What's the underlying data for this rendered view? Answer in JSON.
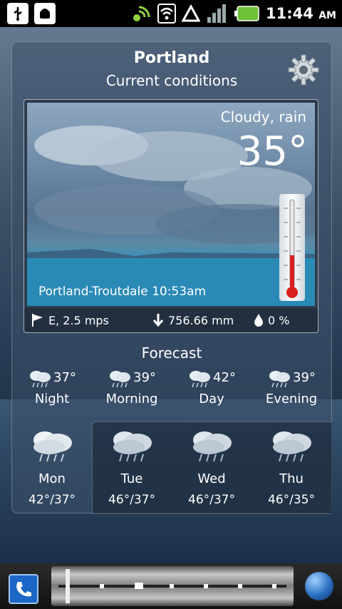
{
  "status_bar": {
    "time": "11:44",
    "ampm": "AM",
    "left_icons": [
      "usb-icon",
      "android-debug-icon"
    ],
    "right_icons": [
      "satellite-icon",
      "wifi-icon",
      "data-triangle-icon",
      "signal-icon",
      "battery-icon"
    ]
  },
  "header": {
    "city": "Portland",
    "subtitle": "Current conditions",
    "settings_icon": "gear-icon"
  },
  "current": {
    "condition": "Cloudy, rain",
    "temperature": "35°",
    "station": "Portland-Troutdale 10:53am",
    "wind": "E, 2.5 mps",
    "pressure": "756.66 mm",
    "precip": "0 %"
  },
  "forecast": {
    "title": "Forecast",
    "day_parts": [
      {
        "name": "Night",
        "temp": "37°"
      },
      {
        "name": "Morning",
        "temp": "39°"
      },
      {
        "name": "Day",
        "temp": "42°"
      },
      {
        "name": "Evening",
        "temp": "39°"
      }
    ],
    "days": [
      {
        "name": "Mon",
        "range": "42°/37°"
      },
      {
        "name": "Tue",
        "range": "46°/37°"
      },
      {
        "name": "Wed",
        "range": "46°/37°"
      },
      {
        "name": "Thu",
        "range": "46°/35°"
      }
    ]
  },
  "dock": {
    "left_icon": "phone-icon",
    "right_icon": "globe-icon"
  }
}
